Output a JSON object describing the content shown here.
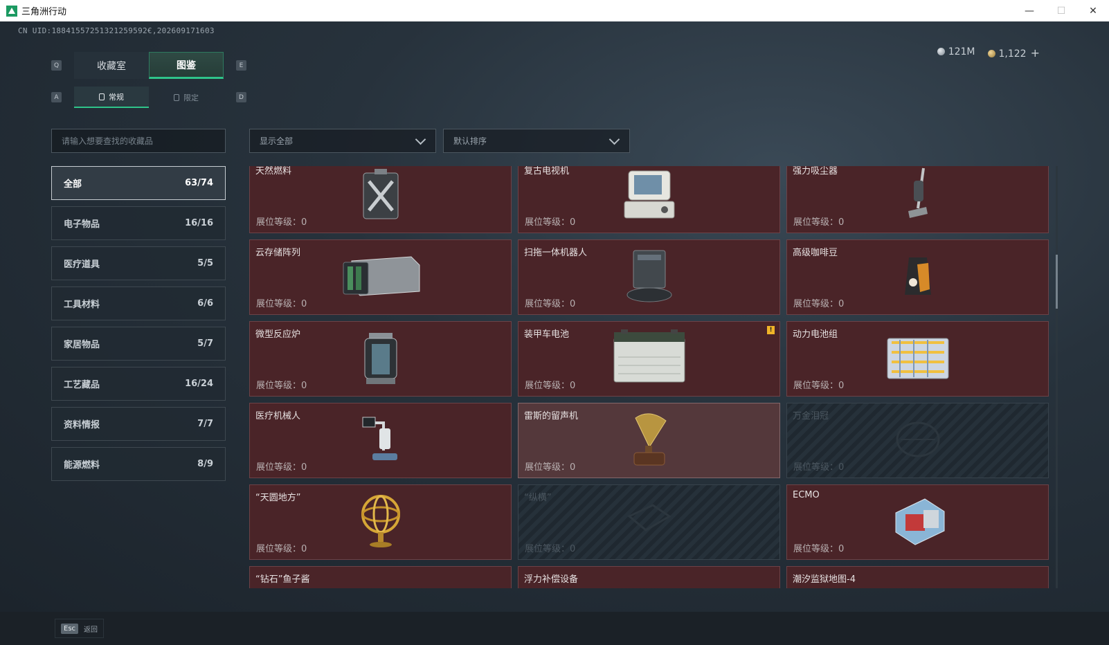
{
  "window": {
    "title": "三角洲行动",
    "minimize": "—",
    "maximize": "☐",
    "close": "✕"
  },
  "uid": "CN UID:18841557251321259592€,202609171603",
  "currency": {
    "silver": "121M",
    "gold": "1,122",
    "plus": "+"
  },
  "keys": {
    "q": "Q",
    "e": "E",
    "a": "A",
    "d": "D"
  },
  "tabs": {
    "collection": "收藏室",
    "codex": "图鉴"
  },
  "subtabs": {
    "normal": "常规",
    "limited": "限定"
  },
  "search": {
    "placeholder": "请输入想要查找的收藏品"
  },
  "filters": {
    "show": "显示全部",
    "sort": "默认排序"
  },
  "categories": [
    {
      "label": "全部",
      "count": "63/74"
    },
    {
      "label": "电子物品",
      "count": "16/16"
    },
    {
      "label": "医疗道具",
      "count": "5/5"
    },
    {
      "label": "工具材料",
      "count": "6/6"
    },
    {
      "label": "家居物品",
      "count": "5/7"
    },
    {
      "label": "工艺藏品",
      "count": "16/24"
    },
    {
      "label": "资料情报",
      "count": "7/7"
    },
    {
      "label": "能源燃料",
      "count": "8/9"
    }
  ],
  "level_label": "展位等级：0",
  "items": [
    {
      "name": "天然燃料",
      "icon": "fuel-can-icon",
      "state": "normal"
    },
    {
      "name": "复古电视机",
      "icon": "retro-computer-icon",
      "state": "normal"
    },
    {
      "name": "强力吸尘器",
      "icon": "vacuum-icon",
      "state": "normal"
    },
    {
      "name": "云存储阵列",
      "icon": "storage-array-icon",
      "state": "normal"
    },
    {
      "name": "扫拖一体机器人",
      "icon": "robot-vacuum-icon",
      "state": "normal"
    },
    {
      "name": "高级咖啡豆",
      "icon": "coffee-bag-icon",
      "state": "normal"
    },
    {
      "name": "微型反应炉",
      "icon": "reactor-icon",
      "state": "normal"
    },
    {
      "name": "装甲车电池",
      "icon": "battery-icon",
      "state": "normal",
      "warn": "!"
    },
    {
      "name": "动力电池组",
      "icon": "battery-pack-icon",
      "state": "normal"
    },
    {
      "name": "医疗机械人",
      "icon": "medical-robot-icon",
      "state": "normal"
    },
    {
      "name": "雷斯的留声机",
      "icon": "gramophone-icon",
      "state": "highlight"
    },
    {
      "name": "万金泪冠",
      "icon": "crown-icon",
      "state": "locked"
    },
    {
      "name": "“天圆地方”",
      "icon": "armillary-icon",
      "state": "normal"
    },
    {
      "name": "“纵横”",
      "icon": "board-icon",
      "state": "locked"
    },
    {
      "name": "ECMO",
      "icon": "ecmo-icon",
      "state": "normal"
    },
    {
      "name": "“钻石”鱼子酱",
      "icon": "caviar-icon",
      "state": "normal"
    },
    {
      "name": "浮力补偿设备",
      "icon": "bcd-icon",
      "state": "normal"
    },
    {
      "name": "潮汐监狱地图-4",
      "icon": "map-icon",
      "state": "normal"
    }
  ],
  "footer": {
    "key": "Esc",
    "label": "返回"
  },
  "colors": {
    "accent": "#2fc48a",
    "card": "#4a2428",
    "warn": "#f0b428"
  }
}
